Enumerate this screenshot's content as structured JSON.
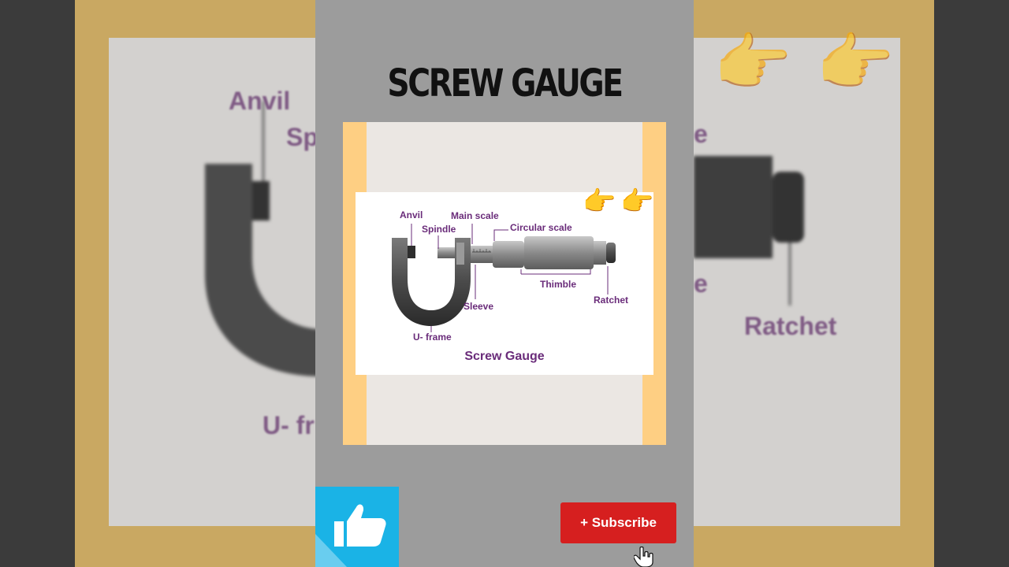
{
  "video": {
    "title": "SCREW GAUGE",
    "subscribe_label": "+ Subscribe"
  },
  "diagram": {
    "caption": "Screw Gauge",
    "labels": {
      "anvil": "Anvil",
      "spindle": "Spindle",
      "main_scale": "Main scale",
      "circular_scale": "Circular scale",
      "thimble": "Thimble",
      "ratchet": "Ratchet",
      "sleeve": "Sleeve",
      "u_frame": "U- frame"
    }
  },
  "background": {
    "labels": [
      "Anvil",
      "Sp",
      "U- fr",
      "Ratchet",
      "e",
      "e"
    ]
  },
  "icons": [
    "pointing-hand-icon",
    "thumbs-up-icon",
    "cursor-hand-icon"
  ],
  "colors": {
    "label_purple": "#6a2c7a",
    "stripe_yellow": "#fecf83",
    "like_blue": "#1ab3e6",
    "subscribe_red": "#d61f1f"
  }
}
